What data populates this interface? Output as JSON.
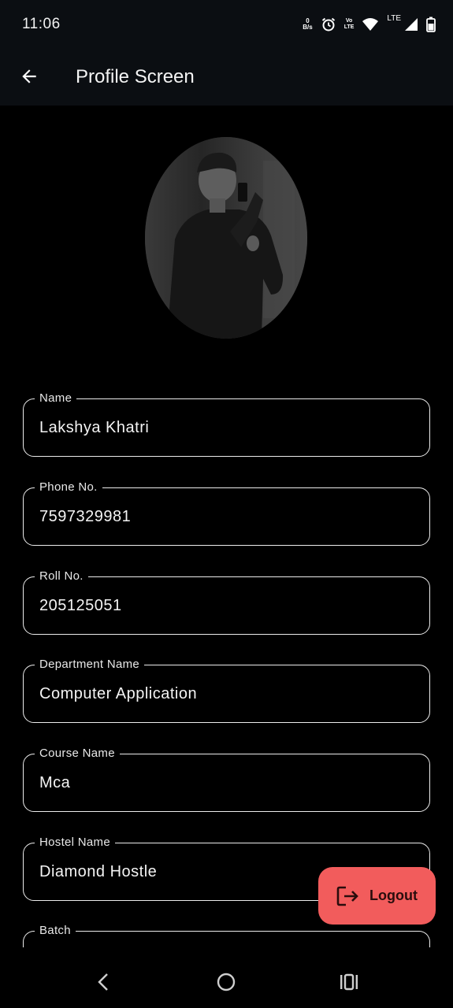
{
  "status_bar": {
    "time": "11:06",
    "net_speed_value": "0",
    "net_speed_unit": "B/s",
    "volte_top": "Vo",
    "volte_bottom": "LTE",
    "lte_label": "LTE",
    "icons": [
      "net-speed-icon",
      "alarm-icon",
      "volte-icon",
      "wifi-icon",
      "signal-icon",
      "battery-icon"
    ]
  },
  "app_bar": {
    "title": "Profile Screen",
    "back_icon": "arrow-back-icon"
  },
  "fields": [
    {
      "label": "Name",
      "value": "Lakshya Khatri"
    },
    {
      "label": "Phone No.",
      "value": "7597329981"
    },
    {
      "label": "Roll No.",
      "value": "205125051"
    },
    {
      "label": "Department Name",
      "value": "Computer Application"
    },
    {
      "label": "Course Name",
      "value": "Mca"
    },
    {
      "label": "Hostel Name",
      "value": "Diamond Hostle"
    },
    {
      "label": "Batch",
      "value": ""
    }
  ],
  "logout": {
    "label": "Logout",
    "color": "#f25c5c",
    "icon": "logout-icon"
  },
  "nav_bar": {
    "icons": [
      "nav-back-icon",
      "nav-home-icon",
      "nav-recents-icon"
    ]
  }
}
